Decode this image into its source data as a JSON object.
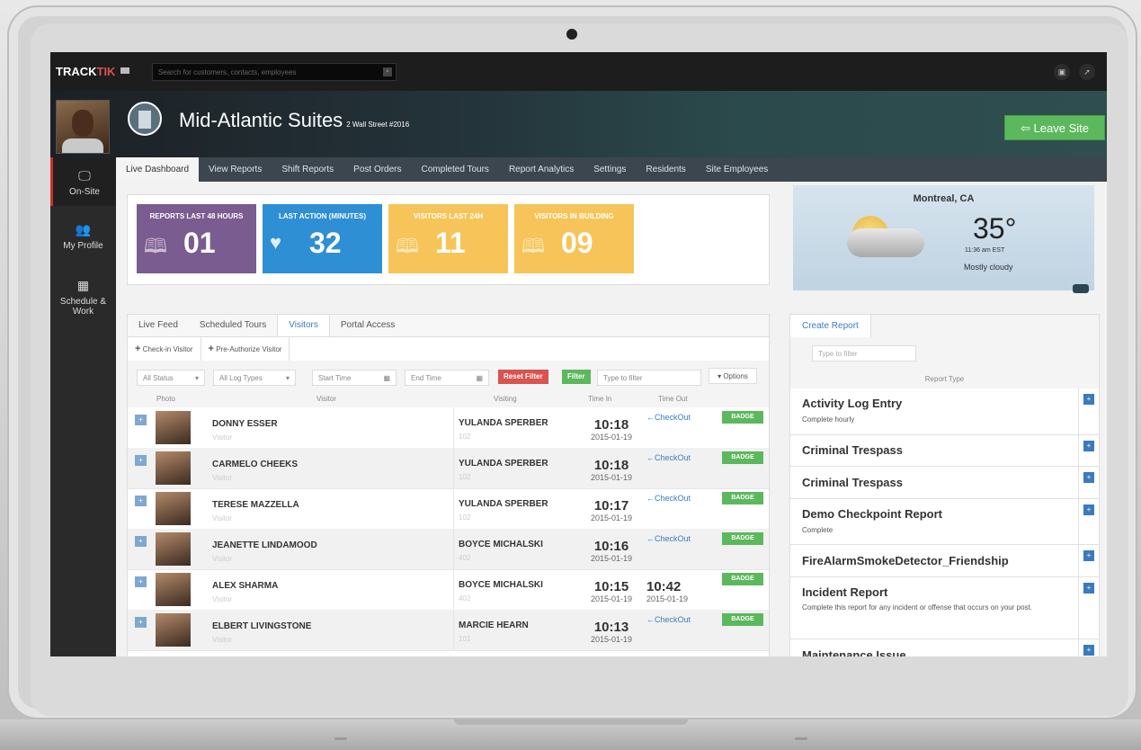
{
  "app": {
    "logo_main": "TRACK",
    "logo_accent": "TIK",
    "search_placeholder": "Search for customers, contacts, employees"
  },
  "site": {
    "name": "Mid-Atlantic Suites",
    "address": "2 Wall Street #2016",
    "leave_label": "Leave Site"
  },
  "leftnav": [
    {
      "label": "On-Site",
      "icon": "monitor-icon"
    },
    {
      "label": "My Profile",
      "icon": "users-icon"
    },
    {
      "label": "Schedule & Work",
      "icon": "calendar-icon"
    }
  ],
  "tabs": [
    "Live Dashboard",
    "View Reports",
    "Shift Reports",
    "Post Orders",
    "Completed Tours",
    "Report Analytics",
    "Settings",
    "Residents",
    "Site Employees"
  ],
  "stats": [
    {
      "label": "REPORTS LAST 48 HOURS",
      "value": "01",
      "color": "#7a5c90",
      "icon": "book-icon"
    },
    {
      "label": "LAST ACTION (MINUTES)",
      "value": "32",
      "color": "#2f8fd5",
      "icon": "heart-icon"
    },
    {
      "label": "VISITORS LAST 24H",
      "value": "11",
      "color": "#f6c458",
      "icon": "book-icon"
    },
    {
      "label": "VISITORS IN BUILDING",
      "value": "09",
      "color": "#f6c458",
      "icon": "book-icon"
    }
  ],
  "weather": {
    "city": "Montreal, CA",
    "temp": "35°",
    "time": "11:36 am EST",
    "condition": "Mostly cloudy"
  },
  "visitors": {
    "tabs": [
      "Live Feed",
      "Scheduled Tours",
      "Visitors",
      "Portal Access"
    ],
    "actions": [
      "Check-in Visitor",
      "Pre-Authorize Visitor"
    ],
    "filters": {
      "status": "All Status",
      "log_types": "All Log Types",
      "start_time": "Start Time",
      "end_time": "End Time",
      "reset": "Reset Filter",
      "filter": "Filter",
      "type_filter": "Type to filter",
      "options": "Options"
    },
    "columns": [
      "Photo",
      "Visitor",
      "Visiting",
      "Time In",
      "Time Out"
    ],
    "rows": [
      {
        "name": "DONNY ESSER",
        "type": "Visitor",
        "host": "YULANDA SPERBER",
        "room": "102",
        "time_in": "10:18",
        "date_in": "2015-01-19",
        "checkout": "←CheckOut",
        "badge": "BADGE"
      },
      {
        "name": "CARMELO CHEEKS",
        "type": "Visitor",
        "host": "YULANDA SPERBER",
        "room": "102",
        "time_in": "10:18",
        "date_in": "2015-01-19",
        "checkout": "←CheckOut",
        "badge": "BADGE"
      },
      {
        "name": "TERESE MAZZELLA",
        "type": "Visitor",
        "host": "YULANDA SPERBER",
        "room": "102",
        "time_in": "10:17",
        "date_in": "2015-01-19",
        "checkout": "←CheckOut",
        "badge": "BADGE"
      },
      {
        "name": "JEANETTE LINDAMOOD",
        "type": "Visitor",
        "host": "BOYCE MICHALSKI",
        "room": "402",
        "time_in": "10:16",
        "date_in": "2015-01-19",
        "checkout": "←CheckOut",
        "badge": "BADGE"
      },
      {
        "name": "ALEX SHARMA",
        "type": "Visitor",
        "host": "BOYCE MICHALSKI",
        "room": "402",
        "time_in": "10:15",
        "date_in": "2015-01-19",
        "time_out": "10:42",
        "date_out": "2015-01-19",
        "badge": "BADGE"
      },
      {
        "name": "ELBERT LIVINGSTONE",
        "type": "Visitor",
        "host": "MARCIE HEARN",
        "room": "101",
        "time_in": "10:13",
        "date_in": "2015-01-19",
        "checkout": "←CheckOut",
        "badge": "BADGE"
      }
    ]
  },
  "reports": {
    "tab": "Create Report",
    "filter_placeholder": "Type to filter",
    "column": "Report Type",
    "items": [
      {
        "title": "Activity Log Entry",
        "sub": "Complete hourly"
      },
      {
        "title": "Criminal Trespass",
        "sub": ""
      },
      {
        "title": "Criminal Trespass",
        "sub": ""
      },
      {
        "title": "Demo Checkpoint Report",
        "sub": "Complete"
      },
      {
        "title": "FireAlarmSmokeDetector_Friendship",
        "sub": ""
      },
      {
        "title": "Incident Report",
        "sub": "Complete this report for any incident or offense that occurs on your post."
      },
      {
        "title": "Maintenance Issue",
        "sub": ""
      }
    ]
  }
}
